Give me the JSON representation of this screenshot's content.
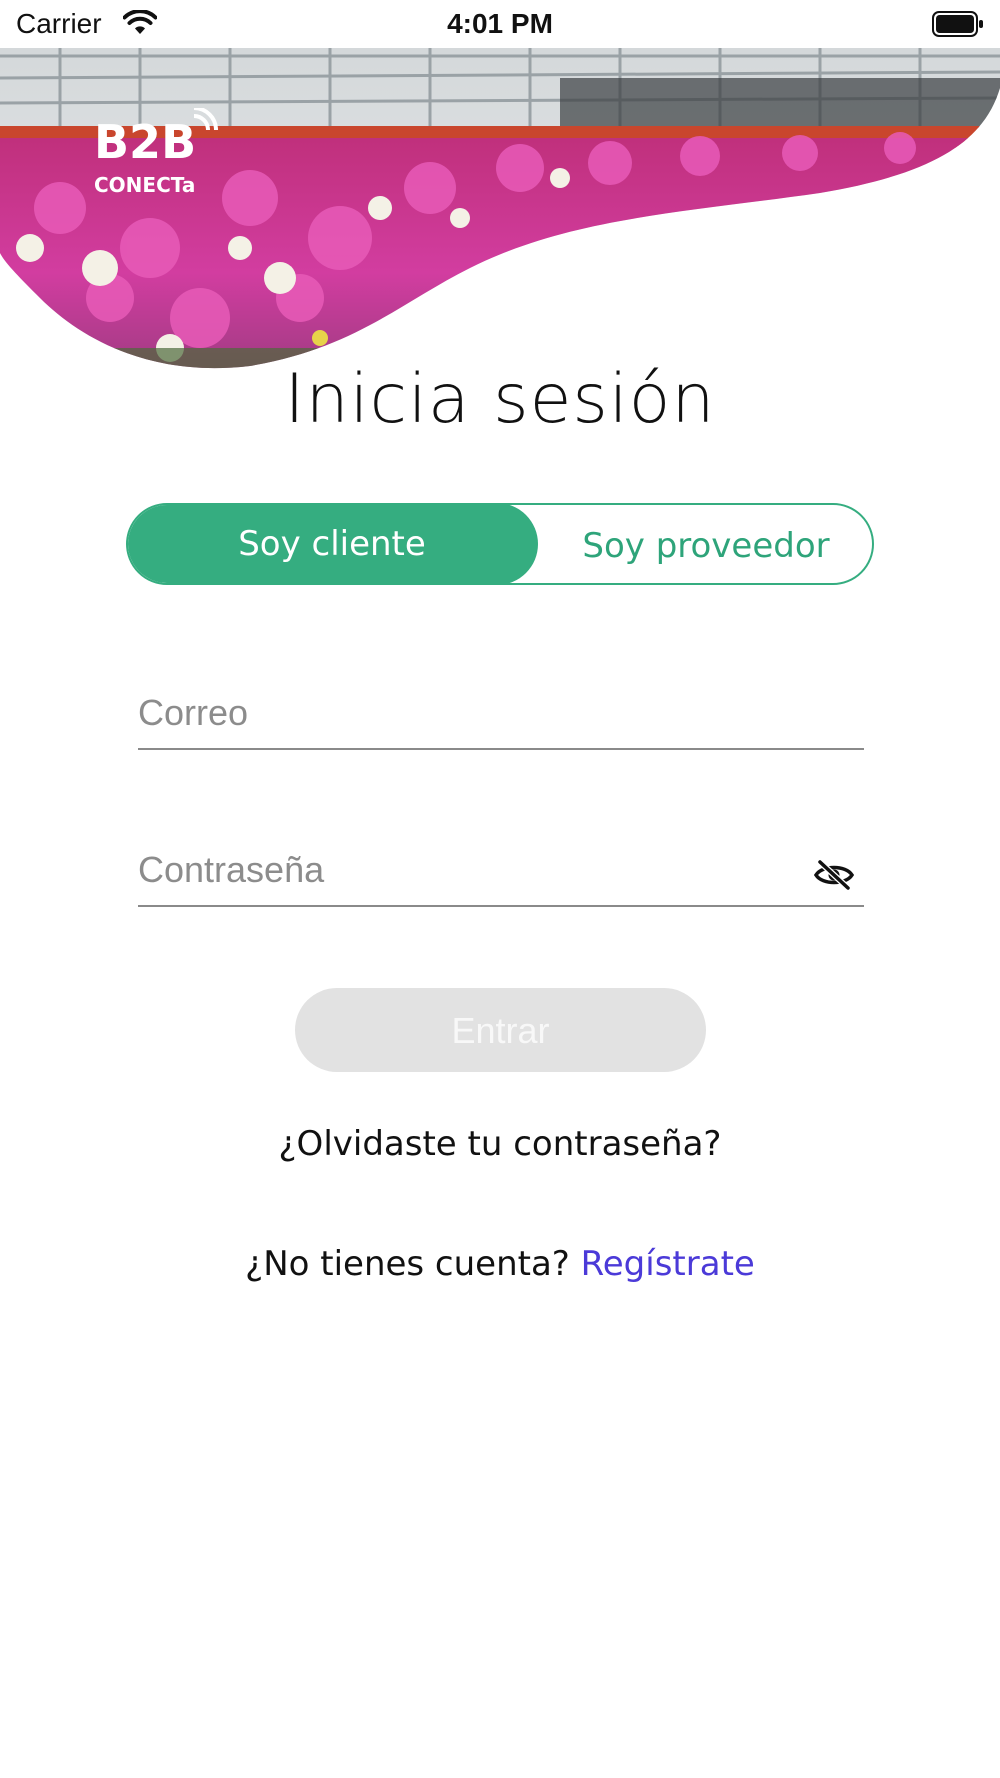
{
  "status_bar": {
    "carrier": "Carrier",
    "time": "4:01 PM",
    "icons": [
      "wifi-icon",
      "battery-icon"
    ]
  },
  "header": {
    "logo_text_top": "B2B",
    "logo_text_bottom": "CONECTa"
  },
  "login": {
    "title": "Inicia sesión",
    "segment": {
      "options": [
        "Soy cliente",
        "Soy proveedor"
      ],
      "selected": "Soy cliente"
    },
    "email": {
      "placeholder": "Correo",
      "value": ""
    },
    "password": {
      "placeholder": "Contraseña",
      "value": "",
      "toggle_icon": "eye-slash-icon"
    },
    "submit_label": "Entrar",
    "forgot_label": "¿Olvidaste tu contraseña?",
    "no_account_label": "¿No tienes cuenta?",
    "register_label": "Regístrate"
  },
  "colors": {
    "accent": "#35ad80",
    "link": "#4b3ad8",
    "disabled_button": "#e2e2e2"
  }
}
